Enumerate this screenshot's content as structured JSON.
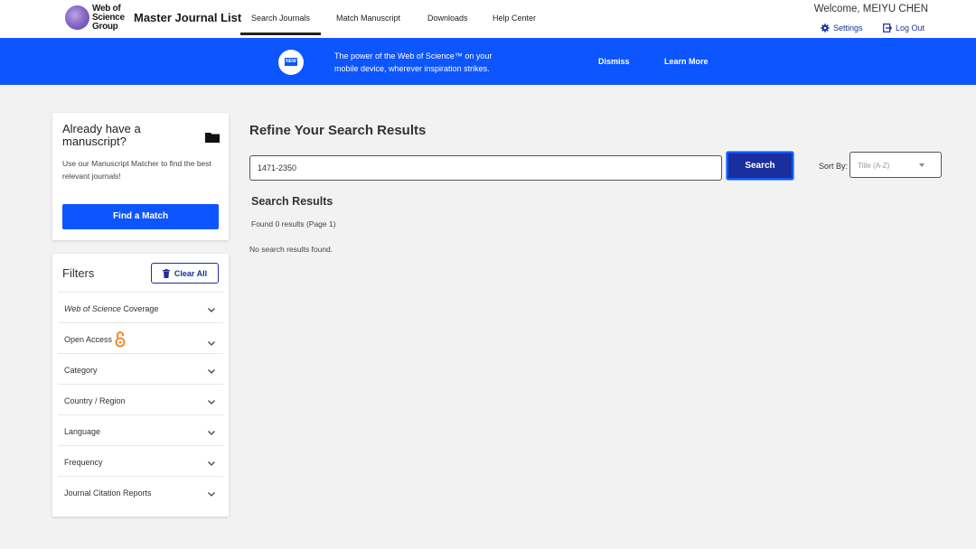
{
  "header": {
    "logo_lines": [
      "Web of",
      "Science",
      "Group"
    ],
    "app_title": "Master Journal List",
    "nav": [
      {
        "label": "Search Journals",
        "active": true
      },
      {
        "label": "Match Manuscript",
        "active": false
      },
      {
        "label": "Downloads",
        "active": false
      },
      {
        "label": "Help Center",
        "active": false
      }
    ],
    "welcome": "Welcome, MEIYU CHEN",
    "settings_label": "Settings",
    "logout_label": "Log Out"
  },
  "banner": {
    "badge": "NEW",
    "line1": "The power of the Web of Science™ on your",
    "line2": "mobile device, wherever inspiration strikes.",
    "dismiss_label": "Dismiss",
    "learn_more_label": "Learn More"
  },
  "manuscript_card": {
    "title": "Already have a manuscript?",
    "description": "Use our Manuscript Matcher to find the best relevant journals!",
    "button_label": "Find a Match"
  },
  "filters": {
    "title": "Filters",
    "clear_label": "Clear All",
    "items": [
      {
        "label": "Web of Science Coverage",
        "italic_part": "Web of Science",
        "rest": " Coverage"
      },
      {
        "label": "Open Access",
        "icon": "open-access-icon"
      },
      {
        "label": "Category"
      },
      {
        "label": "Country / Region"
      },
      {
        "label": "Language"
      },
      {
        "label": "Frequency"
      },
      {
        "label": "Journal Citation Reports"
      }
    ]
  },
  "main": {
    "refine_title": "Refine Your Search Results",
    "search_value": "1471-2350",
    "search_button": "Search",
    "sort_label": "Sort By:",
    "sort_value": "Title (A-Z)",
    "results_title": "Search Results",
    "results_count": "Found 0 results (Page 1)",
    "no_results": "No search results found."
  },
  "colors": {
    "brand_blue": "#0d55ff",
    "dark_blue": "#1a2e9e",
    "open_access_orange": "#f08a24"
  }
}
